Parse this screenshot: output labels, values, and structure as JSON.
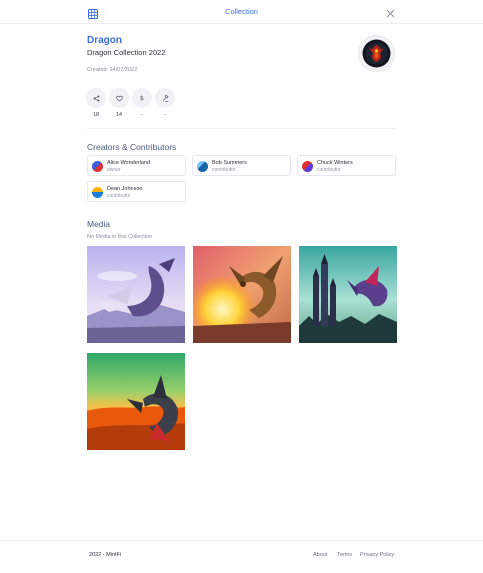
{
  "header": {
    "title": "Collection",
    "grid_icon": "grid-icon",
    "close_icon": "close-icon"
  },
  "collection": {
    "name": "Dragon",
    "subtitle": "Dragon Collection 2022",
    "created": "Created: 24/07/2022"
  },
  "stats": [
    {
      "icon": "share-icon",
      "value": "18"
    },
    {
      "icon": "heart-icon",
      "value": "14"
    },
    {
      "icon": "dollar-icon",
      "value": "-"
    },
    {
      "icon": "hammer-icon",
      "value": "-"
    }
  ],
  "creators_section": {
    "title": "Creators & Contributors",
    "items": [
      {
        "name": "Alice Wonderland",
        "role": "owner",
        "color": "#3b5bdb"
      },
      {
        "name": "Bob Summers",
        "role": "contributor",
        "color": "#1c7ed6"
      },
      {
        "name": "Chuck Winters",
        "role": "contributor",
        "color": "#5c3bdb"
      },
      {
        "name": "Dean Johnson",
        "role": "contributor",
        "color": "#f08c00"
      }
    ]
  },
  "media_section": {
    "title": "Media",
    "note": "No Media in this Collection",
    "items": [
      {
        "name": "dragon-lavender-sky"
      },
      {
        "name": "dragon-fire-breath"
      },
      {
        "name": "dragon-castle"
      },
      {
        "name": "dragon-desert"
      }
    ]
  },
  "footer": {
    "copyright": "2022 - MintFi",
    "links": [
      "About",
      "Terms",
      "Privacy Policy"
    ]
  },
  "colors": {
    "accent": "#3d6ee6",
    "section": "#4a5a82"
  }
}
